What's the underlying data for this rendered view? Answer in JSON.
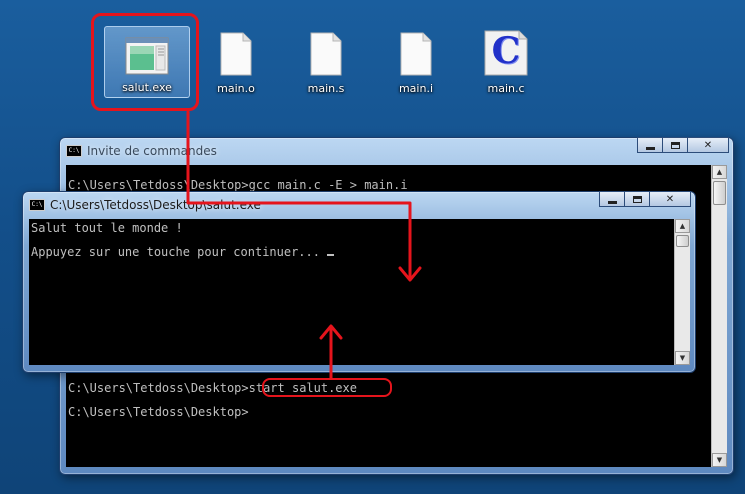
{
  "desktop": {
    "icons": [
      {
        "label": "salut.exe",
        "icon": "application-window-icon"
      },
      {
        "label": "main.o",
        "icon": "blank-document-icon"
      },
      {
        "label": "main.s",
        "icon": "blank-document-icon"
      },
      {
        "label": "main.i",
        "icon": "blank-document-icon"
      },
      {
        "label": "main.c",
        "icon": "c-source-file-icon",
        "glyph": "C"
      }
    ]
  },
  "cmd_window": {
    "title": "Invite de commandes",
    "icon_text": "C:\\",
    "lines": [
      "C:\\Users\\Tetdoss\\Desktop>gcc main.c -E > main.i",
      "C:\\Users\\Tetdoss\\Desktop>start salut.exe",
      "",
      "C:\\Users\\Tetdoss\\Desktop>"
    ]
  },
  "salut_window": {
    "title": "C:\\Users\\Tetdoss\\Desktop\\salut.exe",
    "icon_text": "C:\\",
    "lines": [
      "Salut tout le monde !",
      "",
      "Appuyez sur une touche pour continuer... "
    ]
  },
  "annotations": {
    "highlight_color": "#e5141c"
  },
  "colors": {
    "desktop_bg": "#1a5e9e",
    "console_bg": "#000000",
    "console_text": "#c0c0c0"
  }
}
